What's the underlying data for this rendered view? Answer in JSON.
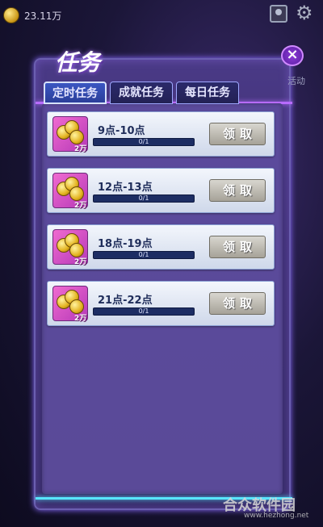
{
  "status_bar": {
    "balance": "23.11万",
    "coin_icon": "coin-icon",
    "avatar_icon": "avatar-icon",
    "settings_icon": "gear-icon"
  },
  "dialog": {
    "title": "任务",
    "close_label": "×",
    "side_label": "活动",
    "tabs": [
      {
        "label": "定时任务",
        "active": true
      },
      {
        "label": "成就任务",
        "active": false
      },
      {
        "label": "每日任务",
        "active": false
      }
    ],
    "tasks": [
      {
        "time": "9点-10点",
        "progress_text": "0/1",
        "progress": 0,
        "reward_amount": "2万",
        "claim_label": "领取"
      },
      {
        "time": "12点-13点",
        "progress_text": "0/1",
        "progress": 0,
        "reward_amount": "2万",
        "claim_label": "领取"
      },
      {
        "time": "18点-19点",
        "progress_text": "0/1",
        "progress": 0,
        "reward_amount": "2万",
        "claim_label": "领取"
      },
      {
        "time": "21点-22点",
        "progress_text": "0/1",
        "progress": 0,
        "reward_amount": "2万",
        "claim_label": "领取"
      }
    ]
  },
  "watermark": {
    "name": "合众软件园",
    "url": "www.hezhong.net"
  },
  "colors": {
    "accent_cyan": "#58e6ff",
    "accent_purple": "#b86bff",
    "panel_bg": "#4a3a86"
  }
}
